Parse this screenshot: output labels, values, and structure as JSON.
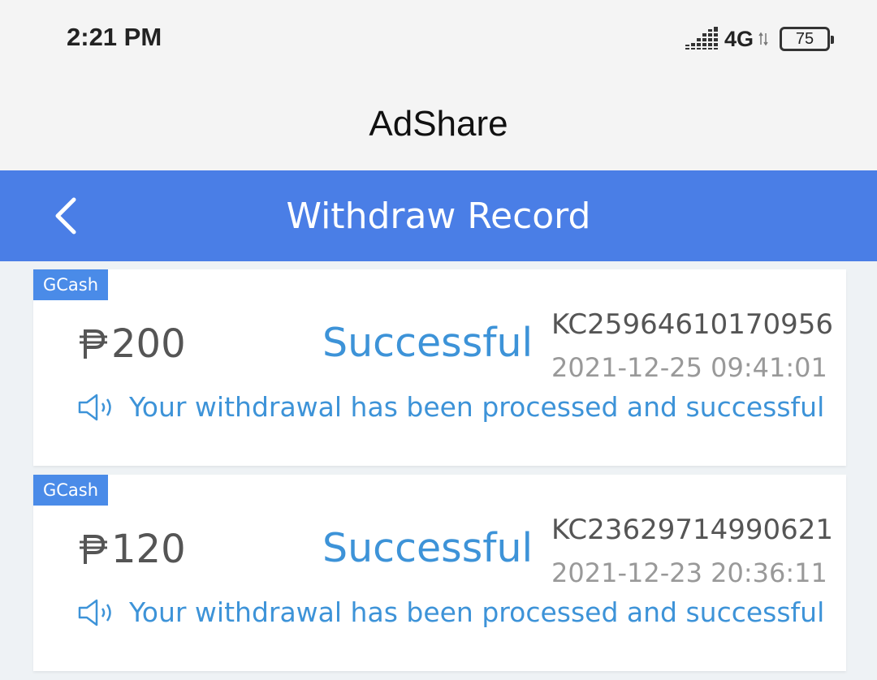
{
  "status_bar": {
    "time": "2:21 PM",
    "network": "4G",
    "battery": "75",
    "icons": [
      "signal-icon",
      "net-arrows-icon",
      "battery-icon"
    ]
  },
  "app": {
    "title": "AdShare"
  },
  "nav": {
    "back_icon": "chevron-left-icon",
    "title": "Withdraw Record"
  },
  "colors": {
    "nav_bg": "#4a7ee6",
    "badge_bg": "#4a8be8",
    "status_text": "#3d93d8"
  },
  "records": [
    {
      "method": "GCash",
      "amount": "200",
      "currency_icon": "peso-icon",
      "status": "Successful",
      "order_id": "KC25964610170956",
      "time": "2021-12-25 09:41:01",
      "notice_icon": "speaker-icon",
      "notice": "Your withdrawal has been processed and successful"
    },
    {
      "method": "GCash",
      "amount": "120",
      "currency_icon": "peso-icon",
      "status": "Successful",
      "order_id": "KC23629714990621",
      "time": "2021-12-23 20:36:11",
      "notice_icon": "speaker-icon",
      "notice": "Your withdrawal has been processed and successful"
    }
  ]
}
